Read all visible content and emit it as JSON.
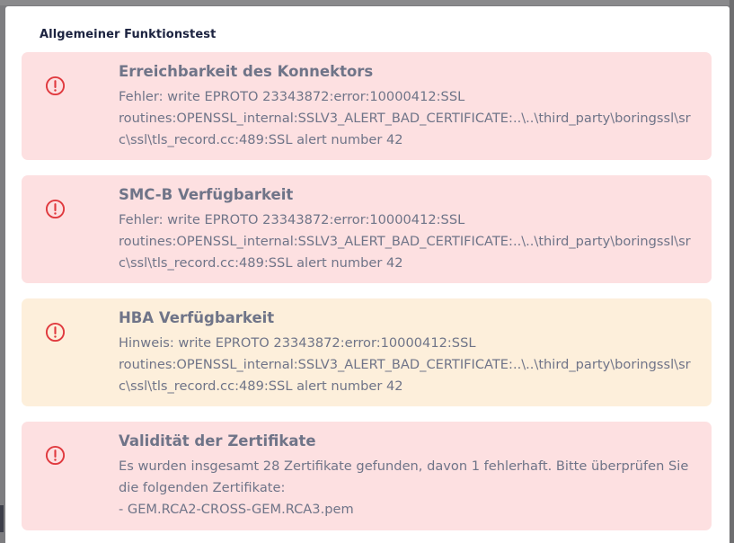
{
  "modal": {
    "title": "Allgemeiner Funktionstest"
  },
  "cards": [
    {
      "status": "error",
      "icon": "error-circle-icon",
      "title": "Erreichbarkeit des Konnektors",
      "message": "Fehler: write EPROTO 23343872:error:10000412:SSL\nroutines:OPENSSL_internal:SSLV3_ALERT_BAD_CERTIFICATE:..\\..\\third_party\\boringssl\\sr\nc\\ssl\\tls_record.cc:489:SSL alert number 42"
    },
    {
      "status": "error",
      "icon": "error-circle-icon",
      "title": "SMC-B Verfügbarkeit",
      "message": "Fehler: write EPROTO 23343872:error:10000412:SSL\nroutines:OPENSSL_internal:SSLV3_ALERT_BAD_CERTIFICATE:..\\..\\third_party\\boringssl\\sr\nc\\ssl\\tls_record.cc:489:SSL alert number 42"
    },
    {
      "status": "warning",
      "icon": "error-circle-icon",
      "title": "HBA Verfügbarkeit",
      "message": "Hinweis: write EPROTO 23343872:error:10000412:SSL\nroutines:OPENSSL_internal:SSLV3_ALERT_BAD_CERTIFICATE:..\\..\\third_party\\boringssl\\sr\nc\\ssl\\tls_record.cc:489:SSL alert number 42"
    },
    {
      "status": "error",
      "icon": "error-circle-icon",
      "title": "Validität der Zertifikate",
      "message": "Es wurden insgesamt 28 Zertifikate gefunden, davon 1 fehlerhaft. Bitte überprüfen Sie\ndie folgenden Zertifikate:\n- GEM.RCA2-CROSS-GEM.RCA3.pem"
    }
  ],
  "colors": {
    "error_bg": "#fde0e1",
    "warning_bg": "#fdefdb",
    "icon_red": "#e0393e",
    "text": "#6f7488"
  }
}
